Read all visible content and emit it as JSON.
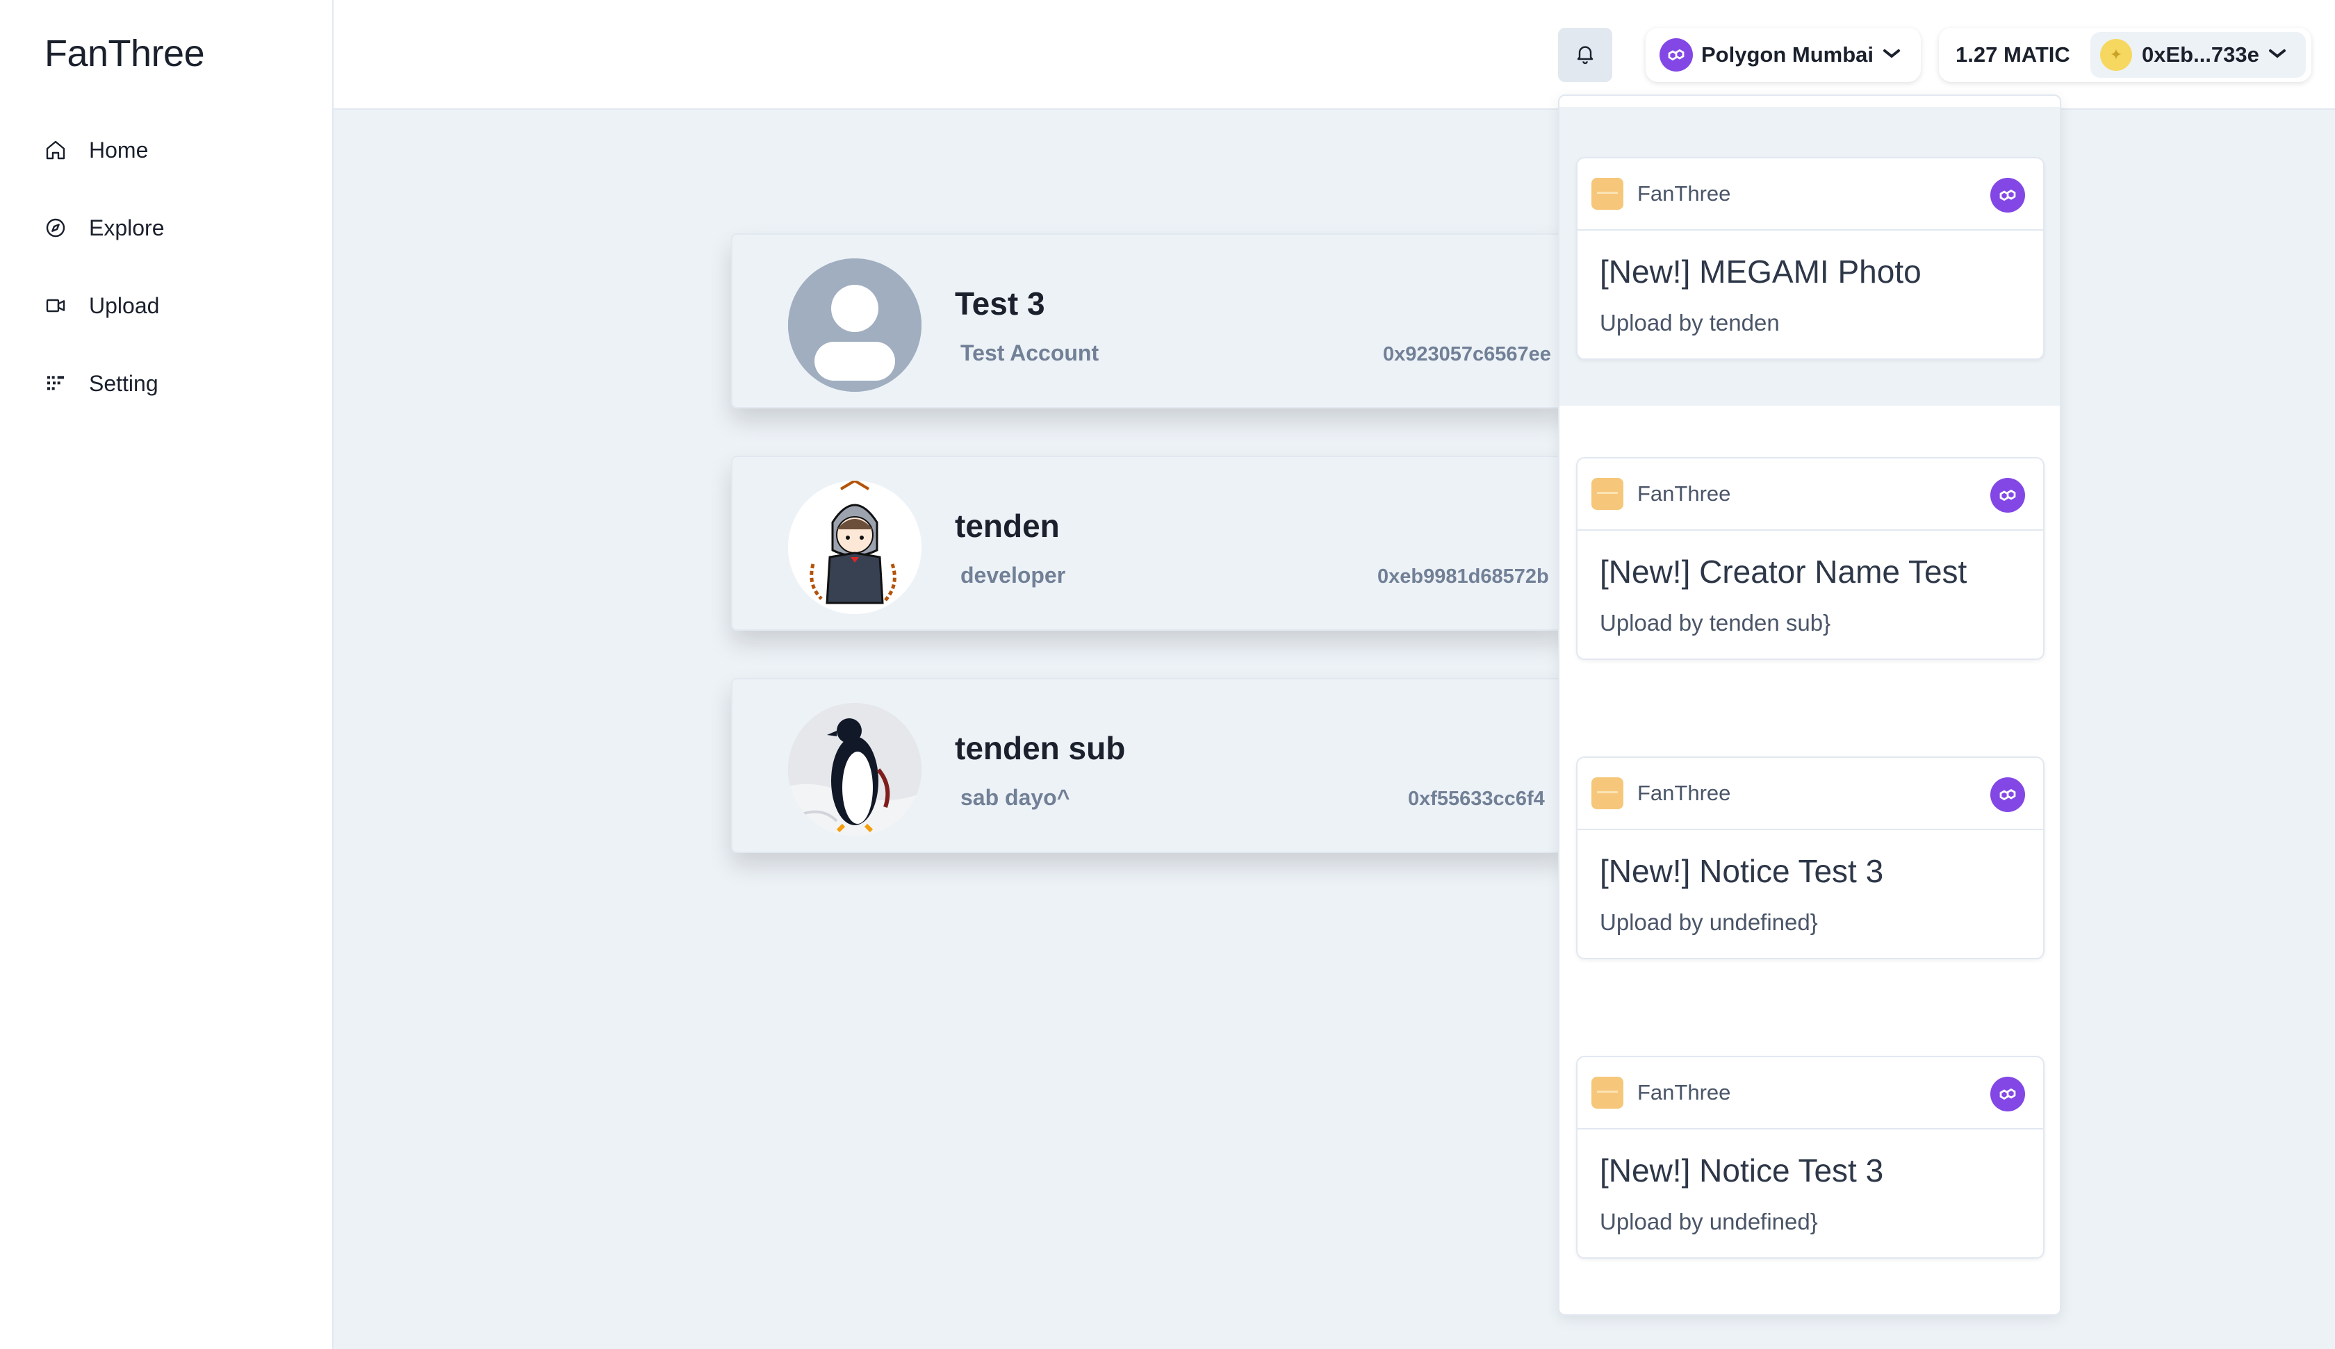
{
  "app": {
    "logo": "FanThree"
  },
  "sidebar": {
    "items": [
      {
        "label": "Home",
        "icon": "home-icon"
      },
      {
        "label": "Explore",
        "icon": "compass-icon"
      },
      {
        "label": "Upload",
        "icon": "video-icon"
      },
      {
        "label": "Setting",
        "icon": "settings-icon"
      }
    ]
  },
  "header": {
    "network": "Polygon Mumbai",
    "balance": "1.27 MATIC",
    "address": "0xEb...733e"
  },
  "creators": [
    {
      "name": "Test 3",
      "description": "Test Account",
      "wallet": "0x923057c6567ee"
    },
    {
      "name": "tenden",
      "description": "developer",
      "wallet": "0xeb9981d68572b"
    },
    {
      "name": "tenden sub",
      "description": "sab dayo^",
      "wallet": "0xf55633cc6f4"
    }
  ],
  "notifications": [
    {
      "app": "FanThree",
      "title": "[New!] MEGAMI Photo",
      "subtitle": "Upload by tenden"
    },
    {
      "app": "FanThree",
      "title": "[New!] Creator Name Test",
      "subtitle": "Upload by tenden sub}"
    },
    {
      "app": "FanThree",
      "title": "[New!] Notice Test 3",
      "subtitle": "Upload by undefined}"
    },
    {
      "app": "FanThree",
      "title": "[New!] Notice Test 3",
      "subtitle": "Upload by undefined}"
    }
  ],
  "colors": {
    "polygon": "#8247e5",
    "background": "#edf2f7",
    "muted_text": "#718096"
  }
}
